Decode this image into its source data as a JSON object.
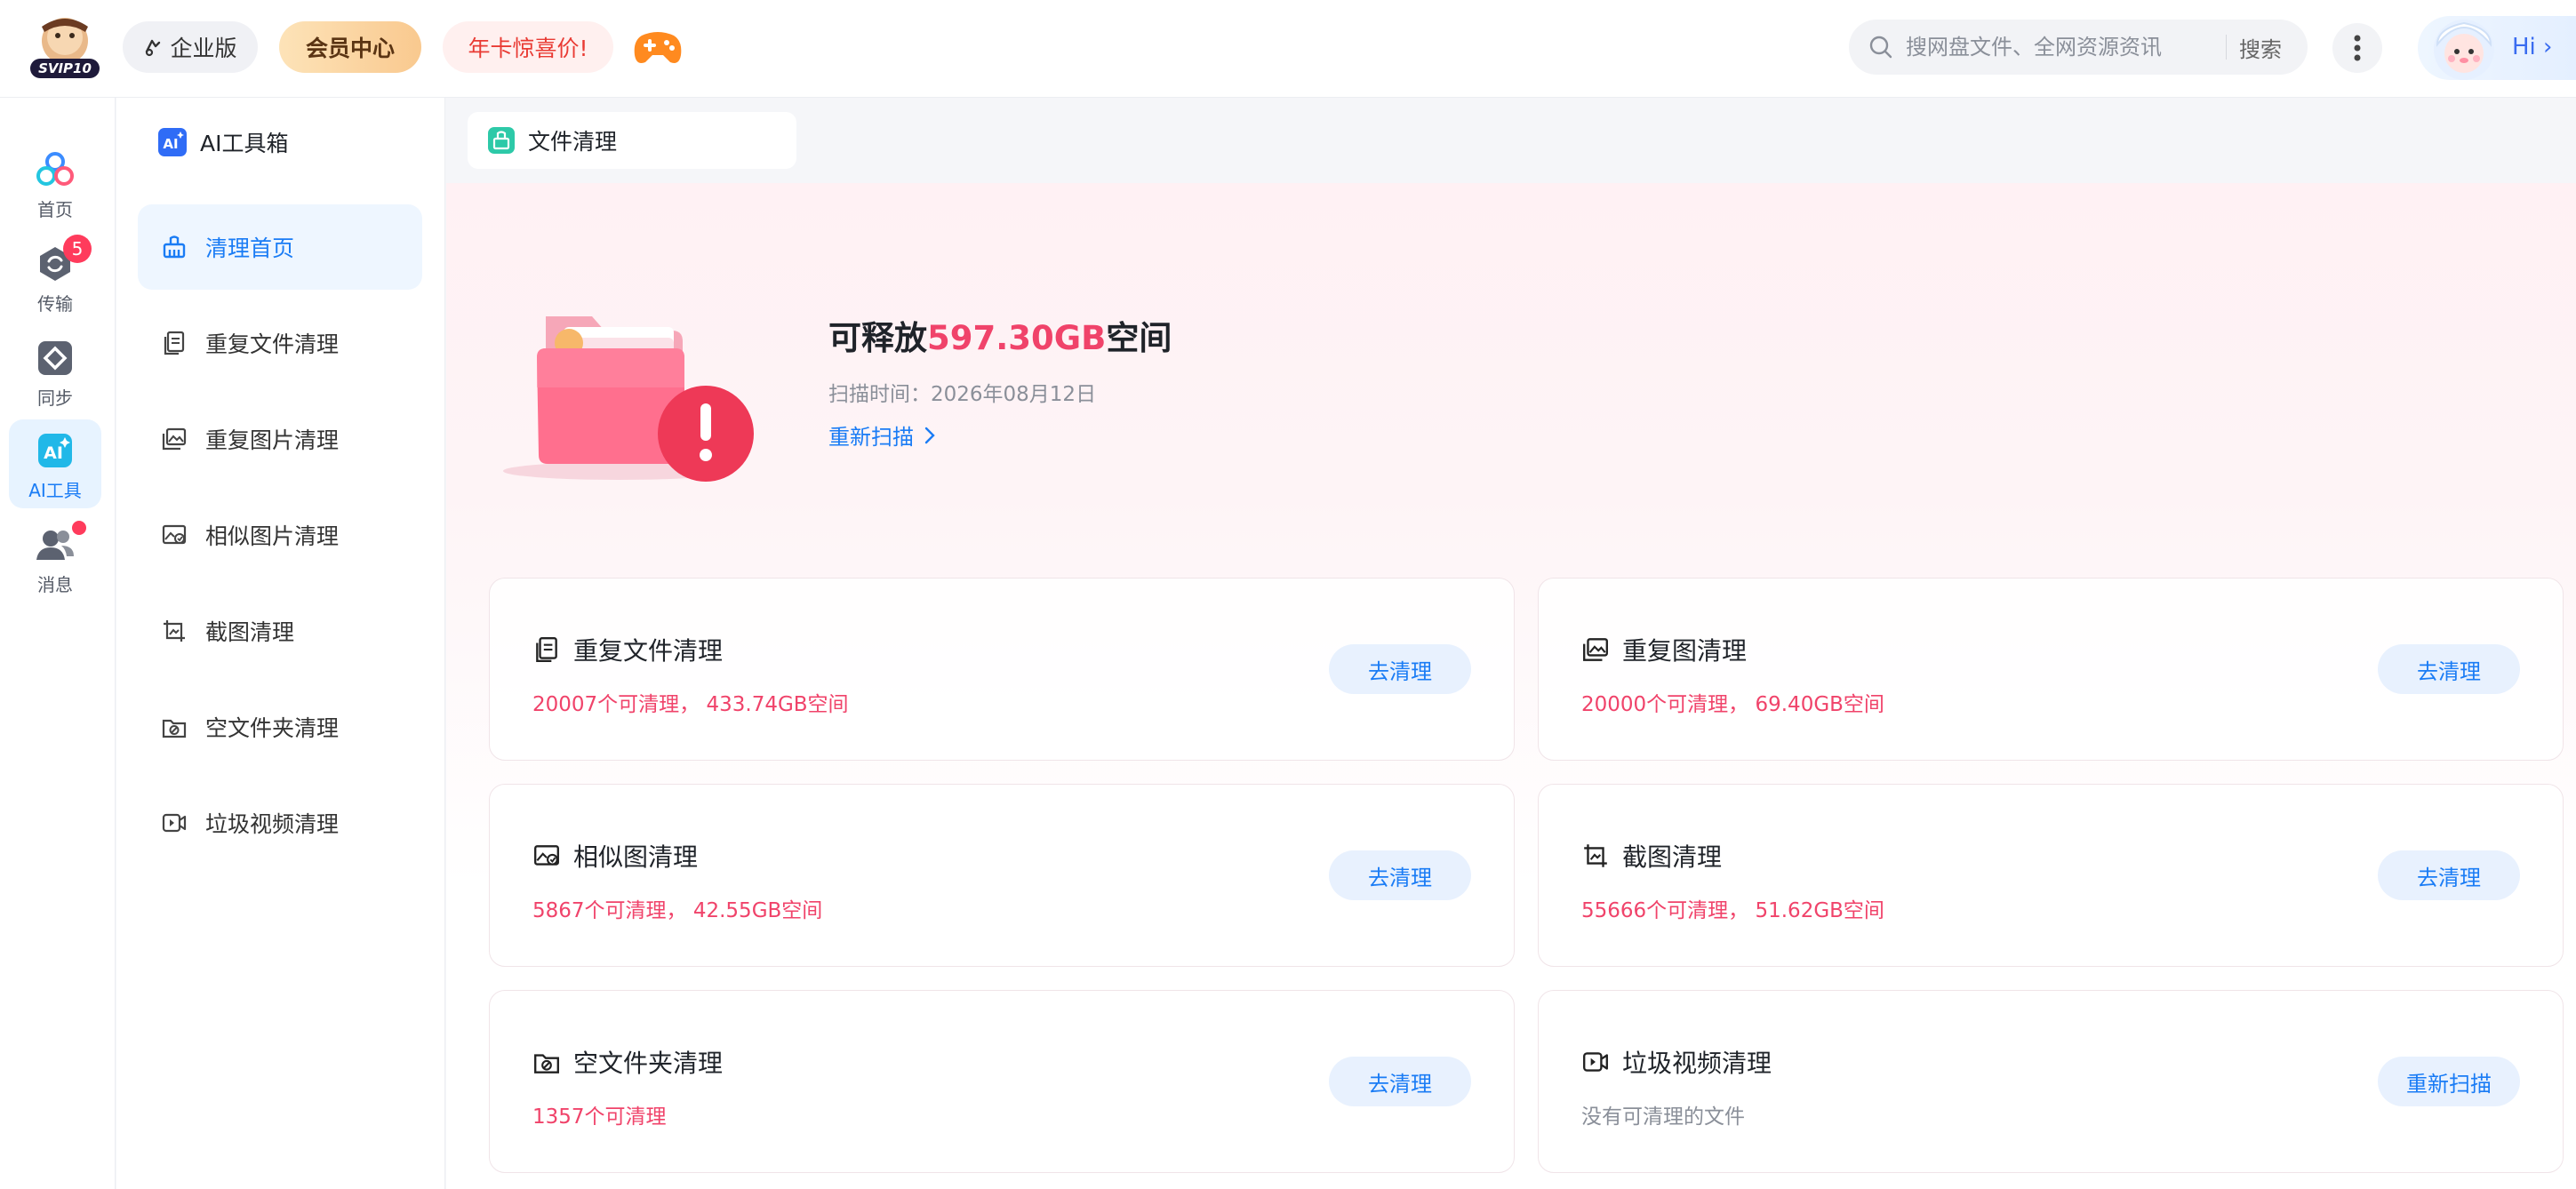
{
  "header": {
    "logo_text": "SVIP10",
    "enterprise_label": "企业版",
    "vip_label": "会员中心",
    "promo_label": "年卡惊喜价!",
    "search_placeholder": "搜网盘文件、全网资源资讯",
    "search_button": "搜索",
    "greeting": "Hi"
  },
  "rail": {
    "items": [
      {
        "label": "首页",
        "icon": "cloud-home-icon"
      },
      {
        "label": "传输",
        "icon": "transfer-icon",
        "badge": "5"
      },
      {
        "label": "同步",
        "icon": "sync-icon"
      },
      {
        "label": "AI工具",
        "icon": "ai-tools-icon",
        "active": true
      },
      {
        "label": "消息",
        "icon": "messages-icon",
        "dot": true
      }
    ]
  },
  "sidebar": {
    "title": "AI工具箱",
    "items": [
      {
        "label": "清理首页",
        "icon": "broom-icon",
        "active": true
      },
      {
        "label": "重复文件清理",
        "icon": "duplicate-file-icon"
      },
      {
        "label": "重复图片清理",
        "icon": "duplicate-image-icon"
      },
      {
        "label": "相似图片清理",
        "icon": "similar-image-icon"
      },
      {
        "label": "截图清理",
        "icon": "screenshot-icon"
      },
      {
        "label": "空文件夹清理",
        "icon": "empty-folder-icon"
      },
      {
        "label": "垃圾视频清理",
        "icon": "junk-video-icon"
      }
    ]
  },
  "tab": {
    "label": "文件清理"
  },
  "hero": {
    "title_prefix": "可释放",
    "title_amount": "597.30GB",
    "title_suffix": "空间",
    "scan_time": "扫描时间：2026年08月12日",
    "rescan_label": "重新扫描"
  },
  "cards": [
    {
      "title": "重复文件清理",
      "stat": "20007个可清理， 433.74GB空间",
      "button": "去清理"
    },
    {
      "title": "重复图清理",
      "stat": "20000个可清理， 69.40GB空间",
      "button": "去清理"
    },
    {
      "title": "相似图清理",
      "stat": "5867个可清理， 42.55GB空间",
      "button": "去清理"
    },
    {
      "title": "截图清理",
      "stat": "55666个可清理， 51.62GB空间",
      "button": "去清理"
    },
    {
      "title": "空文件夹清理",
      "stat": "1357个可清理",
      "button": "去清理"
    },
    {
      "title": "垃圾视频清理",
      "stat": "没有可清理的文件",
      "button": "重新扫描"
    }
  ],
  "colors": {
    "accent": "#1a7cf5",
    "highlight": "#f0436a",
    "badge": "#ff3b5c"
  }
}
